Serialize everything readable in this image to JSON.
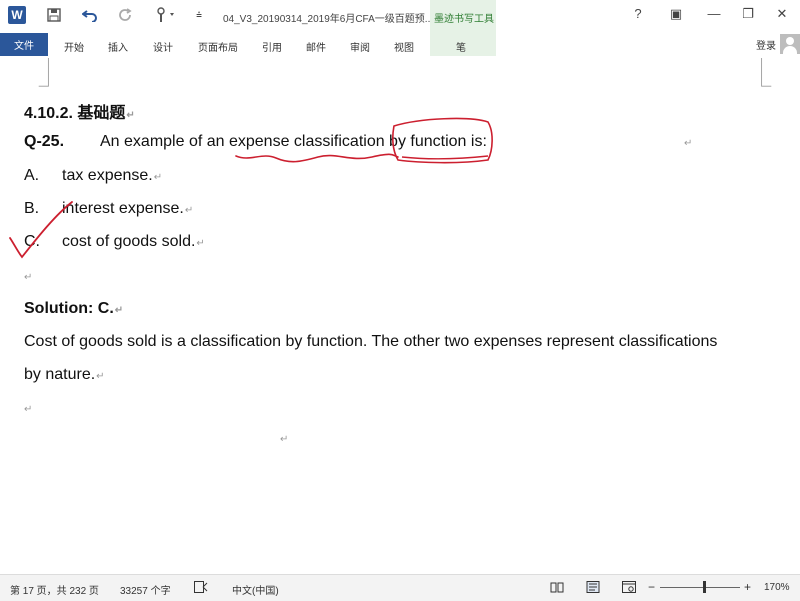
{
  "titlebar": {
    "app_icon": "W",
    "doc_title": "04_V3_20190314_2019年6月CFA一级百题预...",
    "contextual_tool": "墨迹书写工具",
    "help": "?",
    "ribbon_display": "▣",
    "minimize": "—",
    "restore": "❐",
    "close": "✕"
  },
  "ribbon": {
    "file": "文件",
    "tabs": [
      "开始",
      "插入",
      "设计",
      "页面布局",
      "引用",
      "邮件",
      "审阅",
      "视图"
    ],
    "pen": "笔",
    "signin": "登录"
  },
  "document": {
    "section_heading": "4.10.2.  基础题",
    "question": {
      "number": "Q-25.",
      "text": "An example of an expense classification by function is:"
    },
    "options": [
      {
        "letter": "A.",
        "text": "tax expense."
      },
      {
        "letter": "B.",
        "text": "interest expense."
      },
      {
        "letter": "C.",
        "text": "cost of goods sold."
      }
    ],
    "solution_label": "Solution: C.",
    "explanation_line1": "Cost of goods sold is a classification by function. The other two expenses represent classifications",
    "explanation_line2": "by nature.",
    "paragraph_mark": "↵"
  },
  "statusbar": {
    "page": "第 17 页，共 232 页",
    "words": "33257 个字",
    "language": "中文(中国)",
    "zoom": "170%"
  },
  "colors": {
    "accent_blue": "#2b579a",
    "ink_red": "#cc1f2f",
    "tool_tab_green": "#e6f2e6"
  }
}
